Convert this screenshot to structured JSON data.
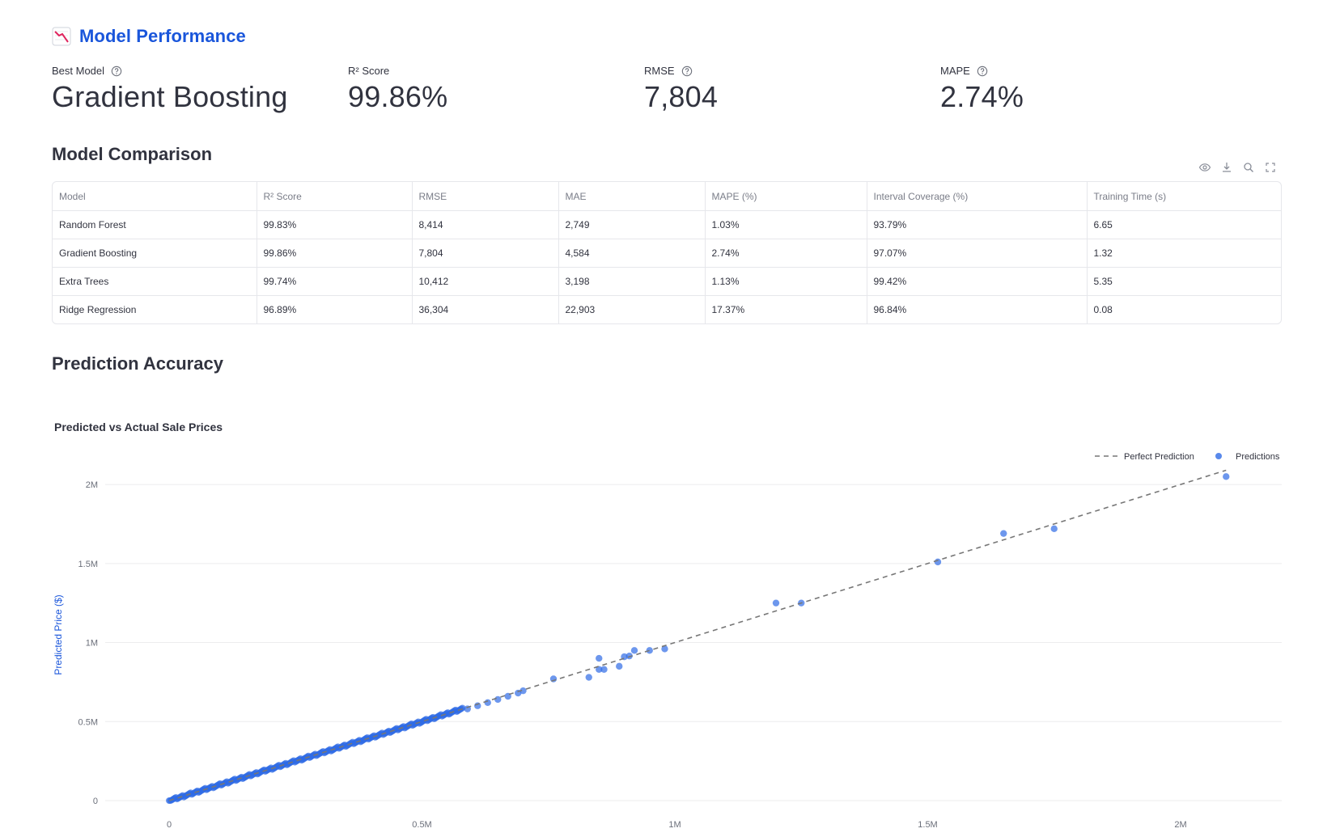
{
  "header": {
    "title": "Model Performance",
    "icon": "chart-decreasing-icon"
  },
  "metrics": [
    {
      "label": "Best Model",
      "value": "Gradient Boosting",
      "has_help": true
    },
    {
      "label": "R² Score",
      "value": "99.86%",
      "has_help": false
    },
    {
      "label": "RMSE",
      "value": "7,804",
      "has_help": true
    },
    {
      "label": "MAPE",
      "value": "2.74%",
      "has_help": true
    }
  ],
  "comparison": {
    "title": "Model Comparison",
    "toolbar": [
      "eye-icon",
      "download-icon",
      "search-icon",
      "fullscreen-icon"
    ],
    "columns": [
      "Model",
      "R² Score",
      "RMSE",
      "MAE",
      "MAPE (%)",
      "Interval Coverage (%)",
      "Training Time (s)"
    ],
    "rows": [
      [
        "Random Forest",
        "99.83%",
        "8,414",
        "2,749",
        "1.03%",
        "93.79%",
        "6.65"
      ],
      [
        "Gradient Boosting",
        "99.86%",
        "7,804",
        "4,584",
        "2.74%",
        "97.07%",
        "1.32"
      ],
      [
        "Extra Trees",
        "99.74%",
        "10,412",
        "3,198",
        "1.13%",
        "99.42%",
        "5.35"
      ],
      [
        "Ridge Regression",
        "96.89%",
        "36,304",
        "22,903",
        "17.37%",
        "96.84%",
        "0.08"
      ]
    ]
  },
  "accuracy": {
    "title": "Prediction Accuracy"
  },
  "colors": {
    "accent": "#1a56db",
    "points": "#2f6be6",
    "line": "#777777",
    "grid": "#ececee"
  },
  "chart_data": {
    "type": "scatter",
    "title": "Predicted vs Actual Sale Prices",
    "ylabel": "Predicted Price ($)",
    "xlabel": "",
    "xlim": [
      0,
      2200000
    ],
    "ylim": [
      0,
      2200000
    ],
    "x_ticks": [
      0,
      500000,
      1000000,
      1500000,
      2000000
    ],
    "x_tick_labels": [
      "0",
      "0.5M",
      "1M",
      "1.5M",
      "2M"
    ],
    "y_ticks": [
      0,
      500000,
      1000000,
      1500000,
      2000000
    ],
    "y_tick_labels": [
      "0",
      "0.5M",
      "1M",
      "1.5M",
      "2M"
    ],
    "grid": true,
    "legend_position": "top-right",
    "series": [
      {
        "name": "Perfect Prediction",
        "kind": "line",
        "dash": true,
        "x": [
          0,
          2090000
        ],
        "y": [
          0,
          2090000
        ]
      },
      {
        "name": "Predictions",
        "kind": "scatter",
        "dense_band": {
          "x_from": 0,
          "x_to": 580000,
          "slope": 1.0
        },
        "points": [
          [
            590000,
            580000
          ],
          [
            610000,
            600000
          ],
          [
            630000,
            620000
          ],
          [
            650000,
            640000
          ],
          [
            670000,
            660000
          ],
          [
            690000,
            680000
          ],
          [
            700000,
            695000
          ],
          [
            760000,
            770000
          ],
          [
            830000,
            780000
          ],
          [
            850000,
            900000
          ],
          [
            850000,
            830000
          ],
          [
            860000,
            830000
          ],
          [
            890000,
            850000
          ],
          [
            900000,
            910000
          ],
          [
            910000,
            915000
          ],
          [
            920000,
            950000
          ],
          [
            950000,
            950000
          ],
          [
            980000,
            960000
          ],
          [
            1200000,
            1250000
          ],
          [
            1250000,
            1250000
          ],
          [
            1520000,
            1510000
          ],
          [
            1650000,
            1690000
          ],
          [
            1750000,
            1720000
          ],
          [
            2090000,
            2050000
          ]
        ]
      }
    ]
  }
}
